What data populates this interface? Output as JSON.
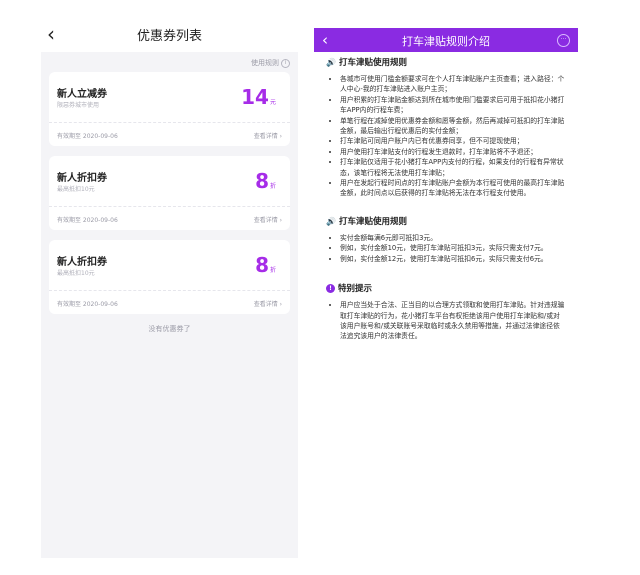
{
  "left": {
    "back_icon": "‹",
    "title": "优惠券列表",
    "rules_label": "使用规则",
    "rules_icon": "i",
    "coupons": [
      {
        "name": "新人立减券",
        "sub": "限惡券城市使用",
        "value": "14",
        "unit": "元",
        "expiry": "有效期至 2020-09-06",
        "detail": "查看详情 ›"
      },
      {
        "name": "新人折扣券",
        "sub": "最高抵扣10元",
        "value": "8",
        "unit": "折",
        "expiry": "有效期至 2020-09-06",
        "detail": "查看详情 ›"
      },
      {
        "name": "新人折扣券",
        "sub": "最高抵扣10元",
        "value": "8",
        "unit": "折",
        "expiry": "有效期至 2020-09-06",
        "detail": "查看详情 ›"
      }
    ],
    "empty_text": "没有优惠券了"
  },
  "right": {
    "back_icon": "‹",
    "title": "打车津贴规则介绍",
    "more_icon": "···",
    "accent": "#8a2be2",
    "sections": [
      {
        "icon": "🔊",
        "title": "打车津贴使用规则",
        "items": [
          "各城市可使用门槛金额要求可在个人打车津贴账户主页查看；进入路径：个人中心-我的打车津贴进入账户主页；",
          "用户积累的打车津贴金额达到所在城市使用门槛要求后可用于抵扣花小猪打车APP内的行程车费；",
          "单笔行程在减掉使用优惠券金额和愿等金额，然后再减掉可抵扣的打车津贴金额，最后输出行程优惠后的实付金额；",
          "打车津贴可同用户账户内已有优惠券同享，但不可提现使用；",
          "用户使用打车津贴支付的行程发生退款时，打车津贴将不予退还；",
          "打车津贴仅适用于花小猪打车APP内支付的行程，如果支付的行程有异常状态，该笔行程将无法使用打车津贴；",
          "用户在发起行程时间点的打车津贴账户金额为本行程可使用的最高打车津贴金额，此时间点以后获得的打车津贴将无法在本行程支付使用。"
        ]
      },
      {
        "icon": "🔊",
        "title": "打车津贴使用规则",
        "items": [
          "实付金额每满6元即可抵扣3元。",
          "例如，实付金额10元，使用打车津贴可抵扣3元，实际只需支付7元。",
          "例如，实付金额12元，使用打车津贴可抵扣6元，实际只需支付6元。"
        ]
      },
      {
        "icon": "!",
        "title": "特别提示",
        "items": [
          "用户应当处于合法、正当目的以合理方式领取和使用打车津贴。针对违规骗取打车津贴的行为，花小猪打车平台有权拒绝该用户使用打车津贴和/或对该用户账号和/或关联账号采取临时或永久禁用等措施，并通过法律途径依法追究该用户的法律责任。"
        ]
      }
    ]
  }
}
